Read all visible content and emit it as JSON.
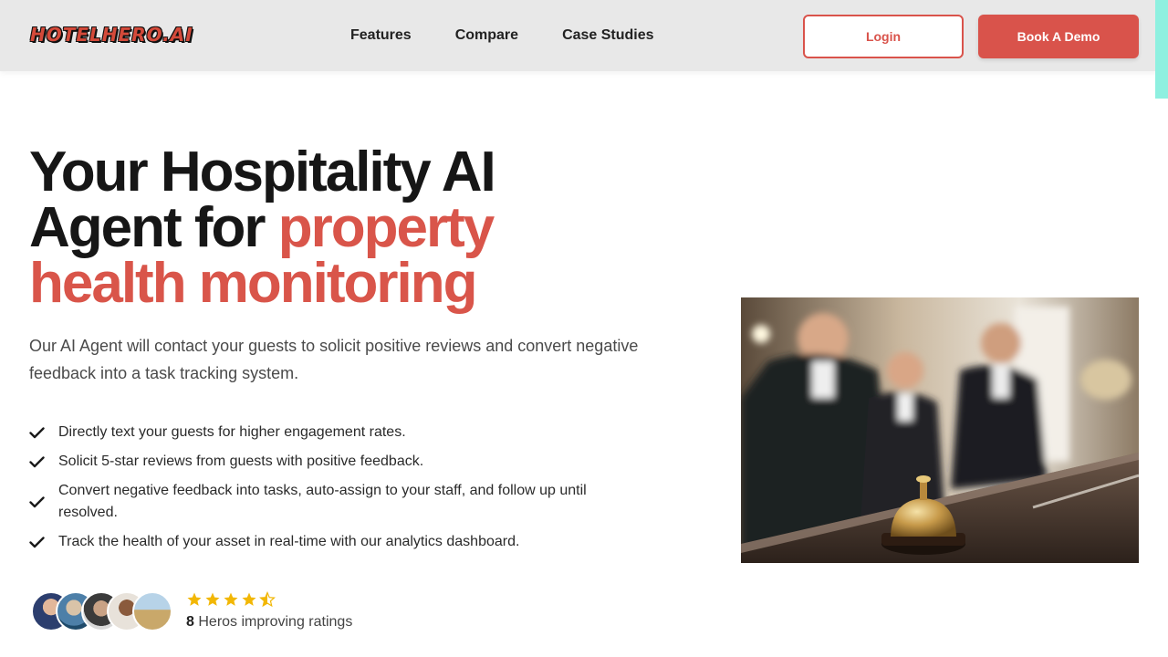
{
  "header": {
    "logo_text": "HOTELHERO.AI",
    "nav": [
      "Features",
      "Compare",
      "Case Studies"
    ],
    "login_label": "Login",
    "demo_label": "Book A Demo"
  },
  "hero": {
    "headline_part1": "Your Hospitality AI Agent for ",
    "headline_accent": "property health monitoring",
    "subtitle": "Our AI Agent will contact your guests to solicit positive reviews and convert negative feedback into a task tracking system.",
    "features": [
      "Directly text your guests for higher engagement rates.",
      "Solicit 5-star reviews from guests with positive feedback.",
      "Convert negative feedback into tasks, auto-assign to your staff, and follow up until resolved.",
      "Track the health of your asset in real-time with our analytics dashboard."
    ]
  },
  "social_proof": {
    "rating_stars": 4.5,
    "count": "8",
    "label": "Heros improving ratings"
  },
  "colors": {
    "accent": "#d9534b",
    "star": "#f2b705",
    "header_bg": "#e8e8e8"
  },
  "icons": {
    "check": "check-icon",
    "star": "star-icon"
  }
}
